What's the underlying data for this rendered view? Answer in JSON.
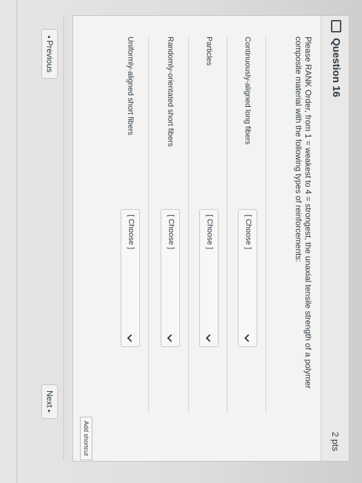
{
  "question": {
    "title": "Question 16",
    "points": "2 pts",
    "prompt_line1": "Please RANK Order, from 1 = weakest to 4 = strongest, the unaxial tensile strength of a polymer",
    "prompt_line2": "composite material with the following types of reinforcements:"
  },
  "rows": [
    {
      "label": "Continuously-aligned long fibers",
      "select_value": "[ Choose ]"
    },
    {
      "label": "Particles",
      "select_value": "[ Choose ]"
    },
    {
      "label": "Randomly-orientated short fibers",
      "select_value": "[ Choose ]"
    },
    {
      "label": "Uniformly-aligned short fibers",
      "select_value": "[ Choose ]"
    }
  ],
  "add_shortcut": "Add shortcut",
  "nav": {
    "previous": "Previous",
    "next": "Next",
    "prev_icon": "◂",
    "next_icon": "▸"
  },
  "icons": {
    "flag": "flag-icon",
    "chevron": "chevron-down-icon"
  }
}
